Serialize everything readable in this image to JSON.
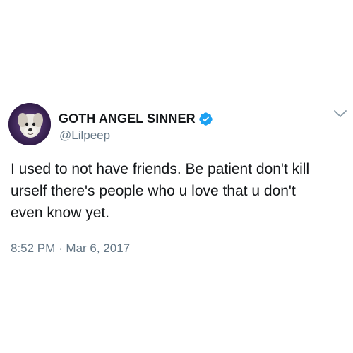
{
  "tweet": {
    "author": {
      "display_name": "GOTH ANGEL SINNER",
      "handle": "@Lilpeep",
      "verified": true,
      "avatar_icon": "avatar-dog-photo",
      "verified_icon": "verified-badge-icon"
    },
    "text_lines": [
      "I used to not have friends. Be patient don't kill",
      "urself there's people who u love that u don't",
      "even know yet."
    ],
    "timestamp": "8:52 PM · Mar 6, 2017",
    "menu_icon": "chevron-down-icon"
  },
  "colors": {
    "text_primary": "#14171a",
    "text_secondary": "#657786",
    "verified_blue": "#1da1f2",
    "background": "#ffffff"
  }
}
